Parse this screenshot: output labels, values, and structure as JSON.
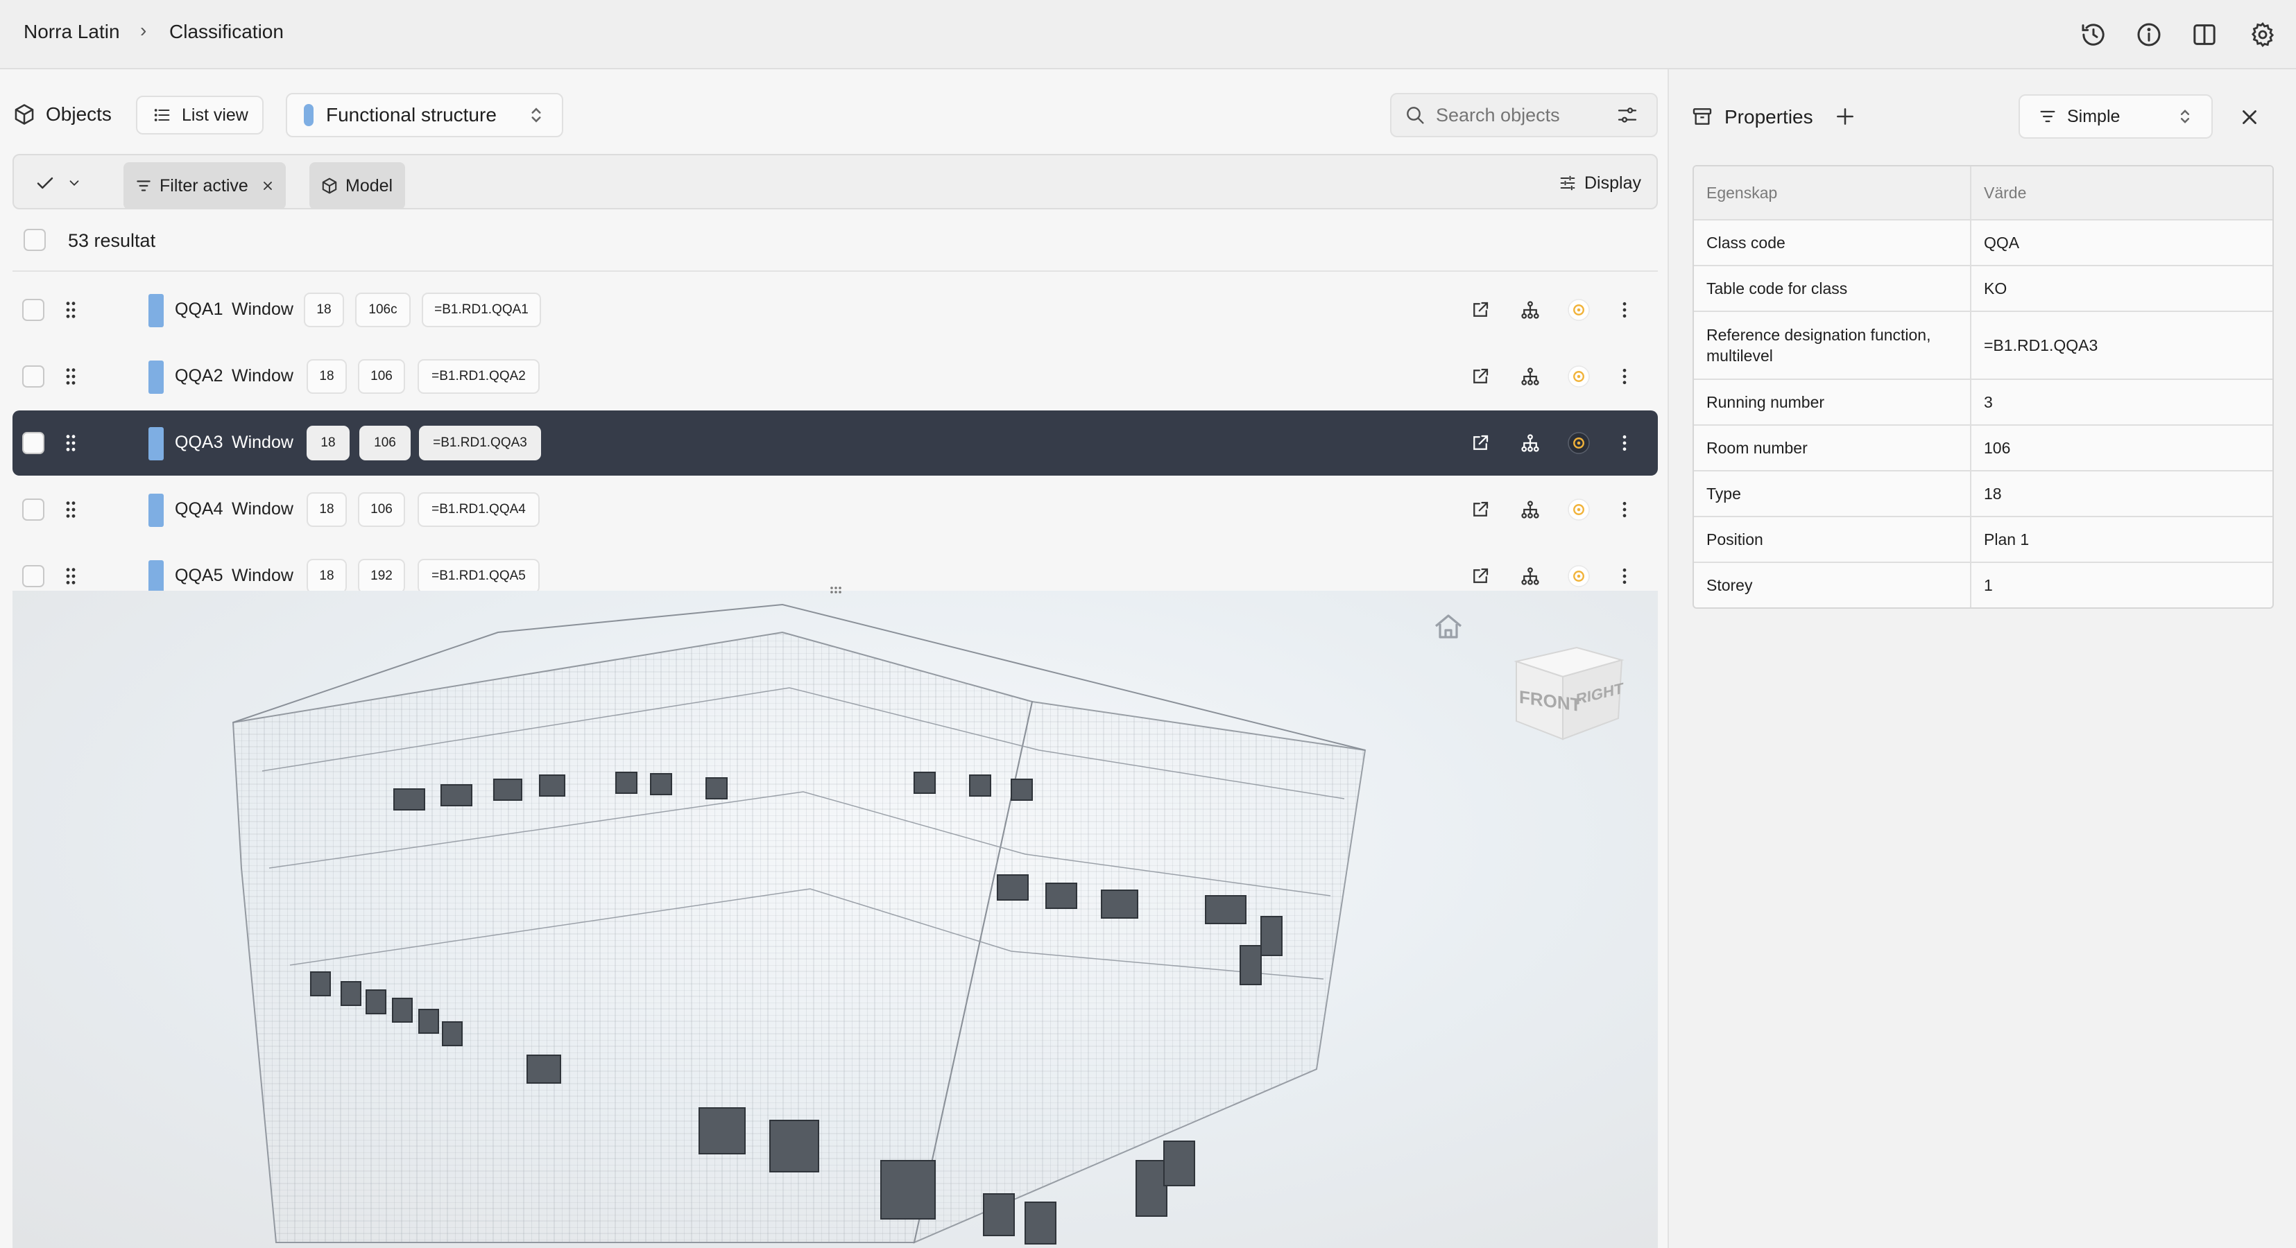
{
  "breadcrumb": {
    "project": "Norra Latin",
    "separator": "›",
    "page": "Classification"
  },
  "topbar_icons": [
    "history-icon",
    "info-icon",
    "split-view-icon",
    "settings-icon"
  ],
  "objects_panel": {
    "title": "Objects",
    "view_button": "List view",
    "structure_select": "Functional structure",
    "search_placeholder": "Search objects"
  },
  "filters": {
    "filter_chip": "Filter active",
    "model_chip": "Model",
    "display_button": "Display"
  },
  "results_label": "53 resultat",
  "rows": [
    {
      "code": "QQA1",
      "name": "Window",
      "type": "18",
      "room": "106c",
      "ref": "=B1.RD1.QQA1",
      "selected": false
    },
    {
      "code": "QQA2",
      "name": "Window",
      "type": "18",
      "room": "106",
      "ref": "=B1.RD1.QQA2",
      "selected": false
    },
    {
      "code": "QQA3",
      "name": "Window",
      "type": "18",
      "room": "106",
      "ref": "=B1.RD1.QQA3",
      "selected": true
    },
    {
      "code": "QQA4",
      "name": "Window",
      "type": "18",
      "room": "106",
      "ref": "=B1.RD1.QQA4",
      "selected": false
    },
    {
      "code": "QQA5",
      "name": "Window",
      "type": "18",
      "room": "192",
      "ref": "=B1.RD1.QQA5",
      "selected": false
    }
  ],
  "viewer": {
    "cube_front": "FRONT",
    "cube_right": "RIGHT"
  },
  "properties": {
    "title": "Properties",
    "mode_select": "Simple",
    "col_property": "Egenskap",
    "col_value": "Värde",
    "items": [
      {
        "key": "Class code",
        "value": "QQA"
      },
      {
        "key": "Table code for class",
        "value": "KO"
      },
      {
        "key": "Reference designation function, multilevel",
        "value": "=B1.RD1.QQA3"
      },
      {
        "key": "Running number",
        "value": "3"
      },
      {
        "key": "Room number",
        "value": "106"
      },
      {
        "key": "Type",
        "value": "18"
      },
      {
        "key": "Position",
        "value": "Plan 1"
      },
      {
        "key": "Storey",
        "value": "1"
      }
    ]
  },
  "colors": {
    "accent_blue": "#7eaee3",
    "selected_row": "#363c49",
    "orange_badge": "#f1b33a"
  }
}
